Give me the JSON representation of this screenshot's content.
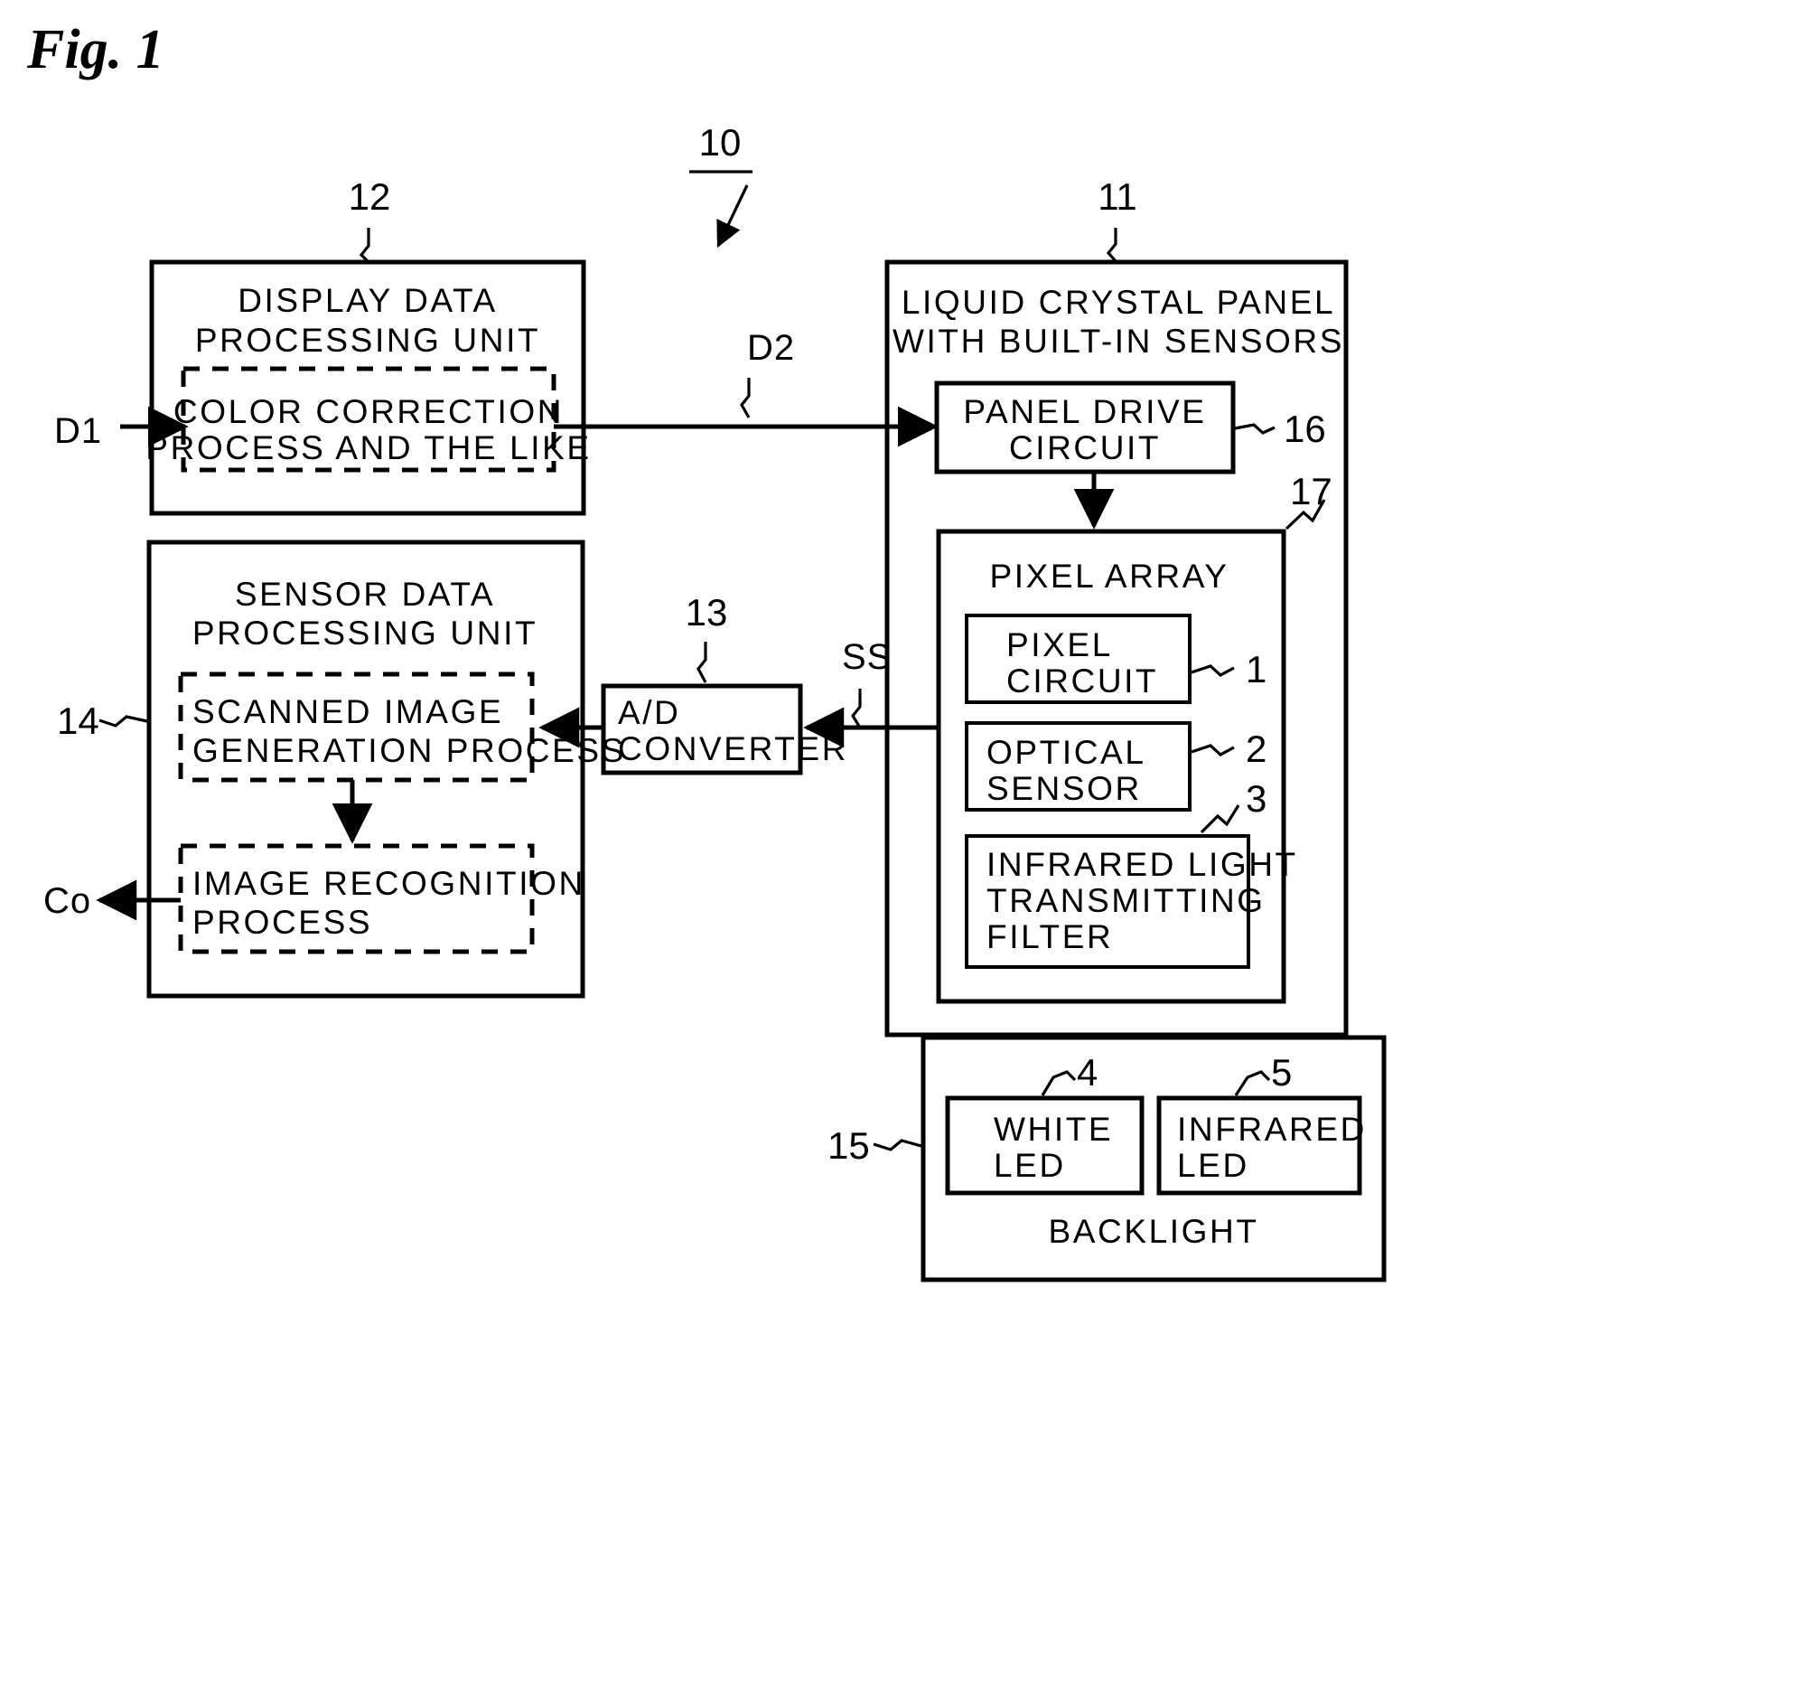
{
  "figure": {
    "title": "Fig. 1",
    "type": "patent-block-diagram"
  },
  "signals": {
    "d1": "D1",
    "d2": "D2",
    "ss": "SS",
    "co": "Co"
  },
  "references": {
    "system": "10",
    "panel": "11",
    "display_unit": "12",
    "ad_converter": "13",
    "sensor_unit": "14",
    "backlight": "15",
    "panel_drive": "16",
    "pixel_array": "17",
    "pixel_circuit": "1",
    "optical_sensor": "2",
    "ir_filter": "3",
    "white_led": "4",
    "infrared_led": "5"
  },
  "blocks": {
    "display_data_unit": {
      "line1": "DISPLAY DATA",
      "line2": "PROCESSING UNIT"
    },
    "color_correction": {
      "line1": "COLOR CORRECTION",
      "line2": "PROCESS AND THE LIKE"
    },
    "sensor_data_unit": {
      "line1": "SENSOR DATA",
      "line2": "PROCESSING UNIT"
    },
    "scanned_image": {
      "line1": "SCANNED IMAGE",
      "line2": "GENERATION PROCESS"
    },
    "image_recognition": {
      "line1": "IMAGE RECOGNITION",
      "line2": "PROCESS"
    },
    "ad_converter": {
      "line1": "A/D",
      "line2": "CONVERTER"
    },
    "lcd_panel": {
      "line1": "LIQUID CRYSTAL PANEL",
      "line2": "WITH BUILT-IN SENSORS"
    },
    "panel_drive_circuit": {
      "line1": "PANEL DRIVE",
      "line2": "CIRCUIT"
    },
    "pixel_array": {
      "line1": "PIXEL ARRAY"
    },
    "pixel_circuit": {
      "line1": "PIXEL",
      "line2": "CIRCUIT"
    },
    "optical_sensor": {
      "line1": "OPTICAL",
      "line2": "SENSOR"
    },
    "ir_filter": {
      "line1": "INFRARED LIGHT",
      "line2": "TRANSMITTING",
      "line3": "FILTER"
    },
    "white_led": {
      "line1": "WHITE",
      "line2": "LED"
    },
    "infrared_led": {
      "line1": "INFRARED",
      "line2": "LED"
    },
    "backlight": {
      "line1": "BACKLIGHT"
    }
  },
  "colors": {
    "ink": "#000000",
    "paper": "#ffffff"
  }
}
